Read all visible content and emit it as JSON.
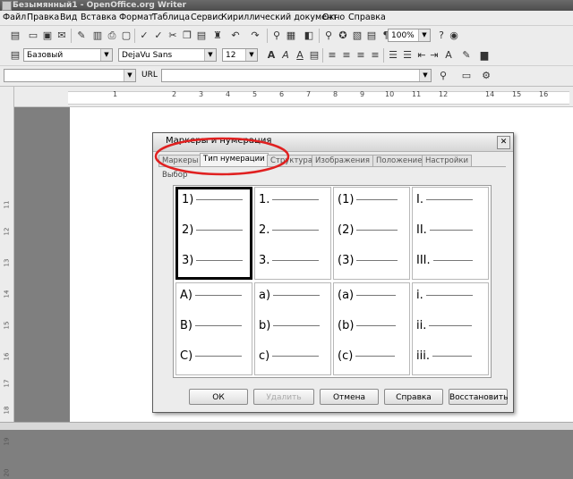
{
  "window": {
    "title": "Безымянный1 - OpenOffice.org Writer"
  },
  "menu": [
    "Файл",
    "Правка",
    "Вид",
    "Вставка",
    "Формат",
    "Таблица",
    "Сервис",
    "Кириллический документ",
    "Окно",
    "Справка"
  ],
  "toolbar1": {
    "zoom": "100%"
  },
  "toolbar2": {
    "style": "Базовый",
    "font": "DejaVu Sans",
    "size": "12"
  },
  "toolbar3": {
    "url_label": "URL"
  },
  "ruler": {
    "h_ticks": [
      "1",
      "2",
      "3",
      "4",
      "5",
      "6",
      "7",
      "8",
      "9",
      "10",
      "11",
      "12",
      "14",
      "15",
      "16"
    ],
    "v_ticks": [
      "11",
      "12",
      "13",
      "14",
      "15",
      "16",
      "17",
      "18",
      "19",
      "20"
    ]
  },
  "dialog": {
    "title": "Маркеры и нумерация",
    "tabs": [
      "Маркеры",
      "Тип нумерации",
      "Структура",
      "Изображения",
      "Положение",
      "Настройки"
    ],
    "active_tab": "Тип нумерации",
    "group_label": "Выбор",
    "cells": [
      {
        "items": [
          "1)",
          "2)",
          "3)"
        ]
      },
      {
        "items": [
          "1.",
          "2.",
          "3."
        ]
      },
      {
        "items": [
          "(1)",
          "(2)",
          "(3)"
        ]
      },
      {
        "items": [
          "I.",
          "II.",
          "III."
        ]
      },
      {
        "items": [
          "A)",
          "B)",
          "C)"
        ]
      },
      {
        "items": [
          "a)",
          "b)",
          "c)"
        ]
      },
      {
        "items": [
          "(a)",
          "(b)",
          "(c)"
        ]
      },
      {
        "items": [
          "i.",
          "ii.",
          "iii."
        ]
      }
    ],
    "selected_cell": 0,
    "buttons": {
      "ok": "ОК",
      "delete": "Удалить",
      "cancel": "Отмена",
      "help": "Справка",
      "reset": "Восстановить"
    }
  },
  "annotation_color": "#e02020"
}
